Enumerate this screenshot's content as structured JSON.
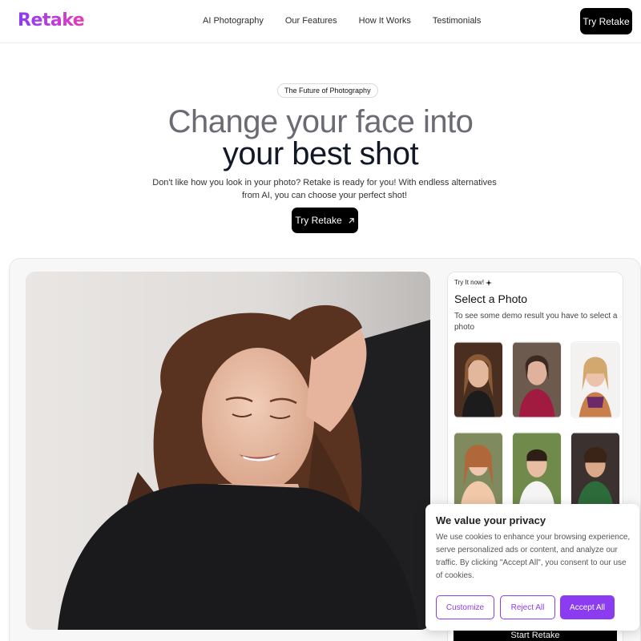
{
  "brand": {
    "logo": "Retake",
    "accent": "#8b3cf0"
  },
  "nav": {
    "links": [
      "AI Photography",
      "Our Features",
      "How It Works",
      "Testimonials"
    ],
    "cta": "Try Retake"
  },
  "hero": {
    "badge": "The Future of Photography",
    "line1": "Change your face into",
    "line2": "your best shot",
    "description": "Don't like how you look in your photo? Retake is ready for you! With endless alternatives from AI, you can choose your perfect shot!",
    "cta": "Try Retake",
    "cta_icon": "arrow-up-right-icon"
  },
  "demo": {
    "tag": "Try It now!",
    "tag_icon": "sparkle-icon",
    "title": "Select a Photo",
    "description": "To see some demo result you have to select a photo",
    "start_button": "Start Retake"
  },
  "cookie": {
    "title": "We value your privacy",
    "text": "We use cookies to enhance your browsing experience, serve personalized ads or content, and analyze our traffic. By clicking \"Accept All\", you consent to our use of cookies.",
    "customize": "Customize",
    "reject": "Reject All",
    "accept": "Accept All"
  }
}
